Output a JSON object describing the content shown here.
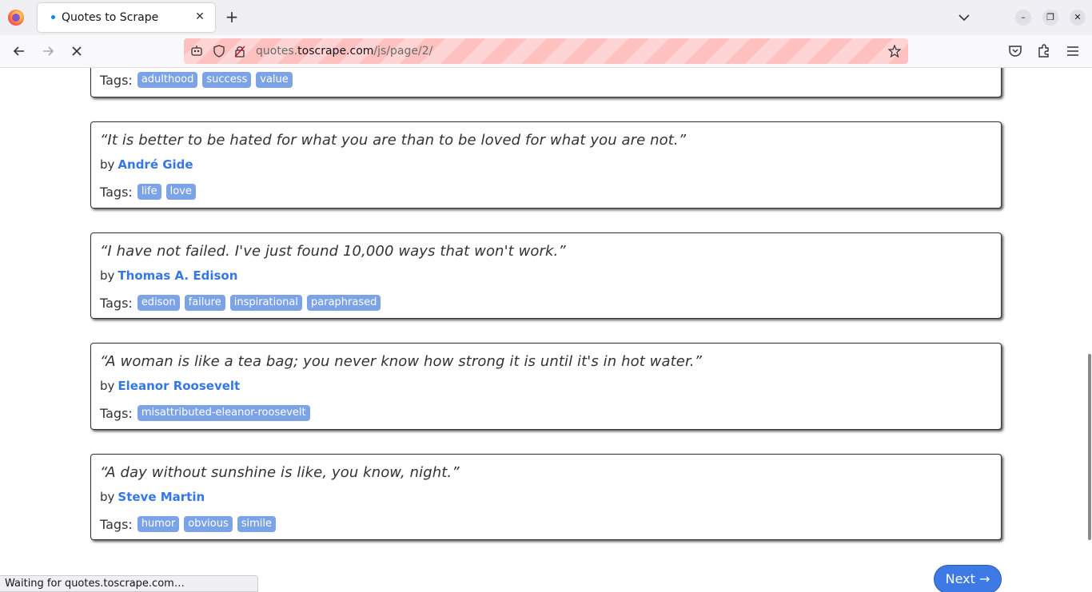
{
  "browser": {
    "tab_title": "Quotes to Scrape",
    "url_prefix": "quotes.",
    "url_domain": "toscrape.com",
    "url_path": "/js/page/2/",
    "status_text": "Waiting for quotes.toscrape.com…"
  },
  "page": {
    "first_tags_label": "Tags:",
    "first_tags": [
      "adulthood",
      "success",
      "value"
    ],
    "by_label": "by",
    "tags_label": "Tags:",
    "quotes": [
      {
        "text": "“It is better to be hated for what you are than to be loved for what you are not.”",
        "author": "André Gide",
        "tags": [
          "life",
          "love"
        ]
      },
      {
        "text": "“I have not failed. I've just found 10,000 ways that won't work.”",
        "author": "Thomas A. Edison",
        "tags": [
          "edison",
          "failure",
          "inspirational",
          "paraphrased"
        ]
      },
      {
        "text": "“A woman is like a tea bag; you never know how strong it is until it's in hot water.”",
        "author": "Eleanor Roosevelt",
        "tags": [
          "misattributed-eleanor-roosevelt"
        ]
      },
      {
        "text": "“A day without sunshine is like, you know, night.”",
        "author": "Steve Martin",
        "tags": [
          "humor",
          "obvious",
          "simile"
        ]
      }
    ],
    "next_label": "Next →"
  },
  "colors": {
    "link": "#3677e8",
    "tag_bg": "#7ca3e6",
    "next_bg": "#3e7ae6"
  }
}
